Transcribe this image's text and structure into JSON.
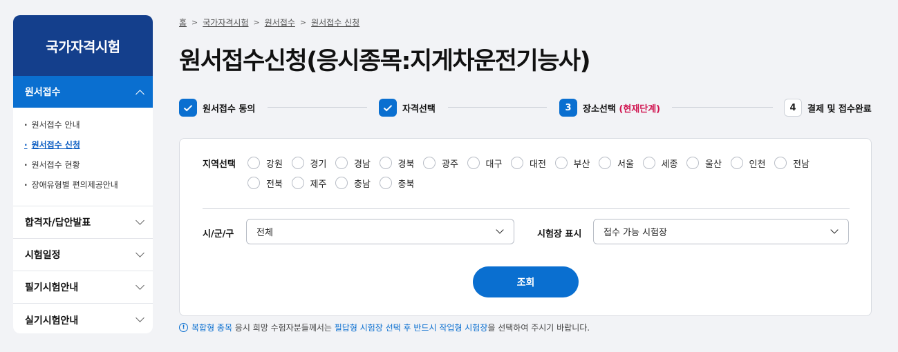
{
  "sidebar": {
    "title": "국가자격시험",
    "active_section": "원서접수",
    "sub_items": [
      "원서접수 안내",
      "원서접수 신청",
      "원서접수 현황",
      "장애유형별 편의제공안내"
    ],
    "current_sub_index": 1,
    "sections": [
      "합격자/답안발표",
      "시험일정",
      "필기시험안내",
      "실기시험안내"
    ]
  },
  "breadcrumb": [
    "홈",
    "국가자격시험",
    "원서접수",
    "원서접수 신청"
  ],
  "page_title": "원서접수신청(응시종목:지게차운전기능사)",
  "steps": [
    {
      "num": "",
      "label": "원서접수 동의",
      "state": "done"
    },
    {
      "num": "",
      "label": "자격선택",
      "state": "done"
    },
    {
      "num": "3",
      "label": "장소선택",
      "current_tag": "(현재단계)",
      "state": "current"
    },
    {
      "num": "4",
      "label": "결제 및 접수완료",
      "state": "pending"
    }
  ],
  "form": {
    "region_label": "지역선택",
    "regions_row1": [
      "강원",
      "경기",
      "경남",
      "경북",
      "광주",
      "대구",
      "대전",
      "부산",
      "서울",
      "세종",
      "울산",
      "인천",
      "전남"
    ],
    "regions_row2": [
      "전북",
      "제주",
      "충남",
      "충북"
    ],
    "city_label": "시/군/구",
    "city_value": "전체",
    "venue_label": "시험장 표시",
    "venue_value": "접수 가능 시험장",
    "search_button": "조회"
  },
  "notice": {
    "icon": "!",
    "part1": "복합형 종목",
    "part2": " 응시 희망 수험자분들께서는 ",
    "part3": "필답형 시험장 선택 후 반드시 작업형 시험장",
    "part4": "을 선택하여 주시기 바랍니다."
  },
  "colors": {
    "primary": "#0a6fd0",
    "sidebar_header": "#143f8c",
    "current_step": "#d0134f"
  }
}
